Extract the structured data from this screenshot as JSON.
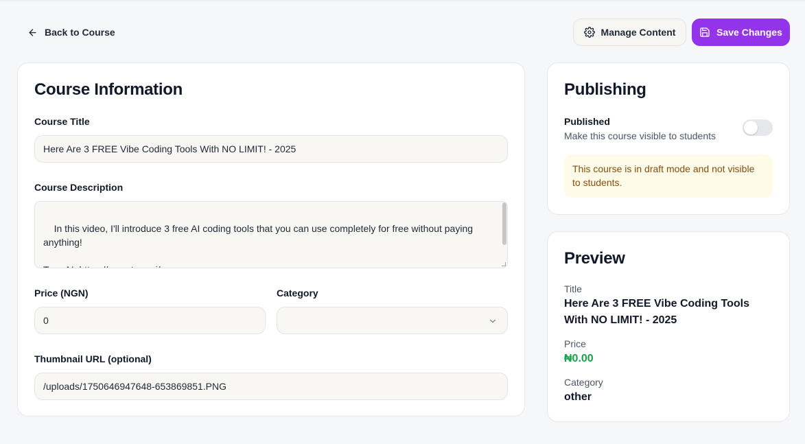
{
  "header": {
    "back_label": "Back to Course",
    "manage_label": "Manage Content",
    "save_label": "Save Changes"
  },
  "course_info": {
    "title": "Course Information",
    "course_title_label": "Course Title",
    "course_title_value": "Here Are 3 FREE Vibe Coding Tools With NO LIMIT! - 2025",
    "description_label": "Course Description",
    "description_value": "In this video, I'll introduce 3 free AI coding tools that you can use completely for free without paying anything!\n\nTrae AI: https://www.trae.ai/\nFirebase Studio: https://firebase.studio/",
    "price_label": "Price (NGN)",
    "price_value": "0",
    "category_label": "Category",
    "category_value": "",
    "thumbnail_label": "Thumbnail URL (optional)",
    "thumbnail_value": "/uploads/1750646947648-653869851.PNG"
  },
  "publishing": {
    "title": "Publishing",
    "published_label": "Published",
    "published_desc": "Make this course visible to students",
    "published": false,
    "notice": "This course is in draft mode and not visible to students."
  },
  "preview": {
    "title": "Preview",
    "title_key": "Title",
    "title_value": "Here Are 3 FREE Vibe Coding Tools With NO LIMIT! - 2025",
    "price_key": "Price",
    "price_value": "₦0.00",
    "category_key": "Category",
    "category_value": "other"
  },
  "colors": {
    "accent": "#9333ea",
    "price": "#16a34a",
    "notice_bg": "#fefbe8",
    "notice_text": "#854d0e"
  },
  "icons": {
    "back": "arrow-left-icon",
    "manage": "gear-icon",
    "save": "save-icon",
    "category": "chevron-down-icon"
  }
}
